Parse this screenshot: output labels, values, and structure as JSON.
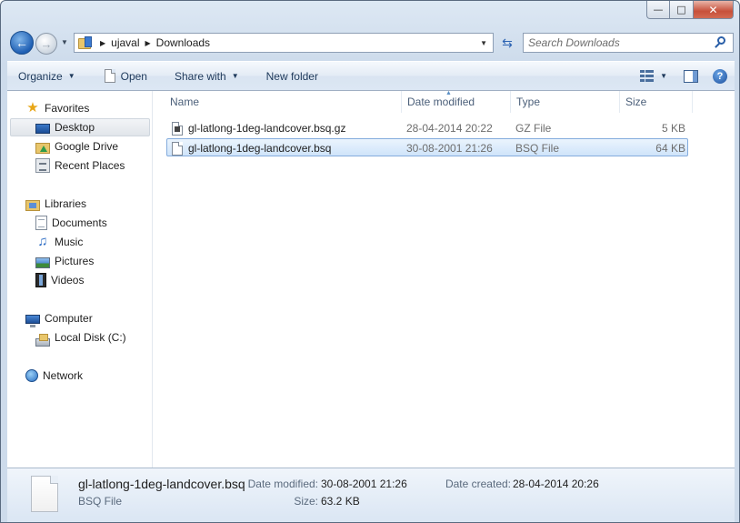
{
  "window": {
    "caption_buttons": {
      "minimize": "—",
      "maximize": "□",
      "close": "✕"
    }
  },
  "address": {
    "crumbs": [
      "ujaval",
      "Downloads"
    ]
  },
  "search": {
    "placeholder": "Search Downloads"
  },
  "toolbar": {
    "organize": "Organize",
    "open": "Open",
    "share_with": "Share with",
    "new_folder": "New folder"
  },
  "sidebar": {
    "favorites": {
      "label": "Favorites",
      "items": [
        {
          "label": "Desktop",
          "icon": "desktop-icon",
          "selected": true
        },
        {
          "label": "Google Drive",
          "icon": "google-drive-icon"
        },
        {
          "label": "Recent Places",
          "icon": "recent-places-icon"
        }
      ]
    },
    "libraries": {
      "label": "Libraries",
      "items": [
        {
          "label": "Documents",
          "icon": "documents-icon"
        },
        {
          "label": "Music",
          "icon": "music-icon"
        },
        {
          "label": "Pictures",
          "icon": "pictures-icon"
        },
        {
          "label": "Videos",
          "icon": "videos-icon"
        }
      ]
    },
    "computer": {
      "label": "Computer",
      "items": [
        {
          "label": "Local Disk (C:)",
          "icon": "local-disk-icon"
        }
      ]
    },
    "network": {
      "label": "Network"
    }
  },
  "file_list": {
    "columns": [
      "Name",
      "Date modified",
      "Type",
      "Size"
    ],
    "rows": [
      {
        "name": "gl-latlong-1deg-landcover.bsq.gz",
        "date": "28-04-2014 20:22",
        "type": "GZ File",
        "size": "5 KB",
        "selected": false
      },
      {
        "name": "gl-latlong-1deg-landcover.bsq",
        "date": "30-08-2001 21:26",
        "type": "BSQ File",
        "size": "64 KB",
        "selected": true
      }
    ]
  },
  "details": {
    "name": "gl-latlong-1deg-landcover.bsq",
    "type": "BSQ File",
    "date_modified_label": "Date modified:",
    "date_modified": "30-08-2001 21:26",
    "size_label": "Size:",
    "size": "63.2 KB",
    "date_created_label": "Date created:",
    "date_created": "28-04-2014 20:26"
  }
}
